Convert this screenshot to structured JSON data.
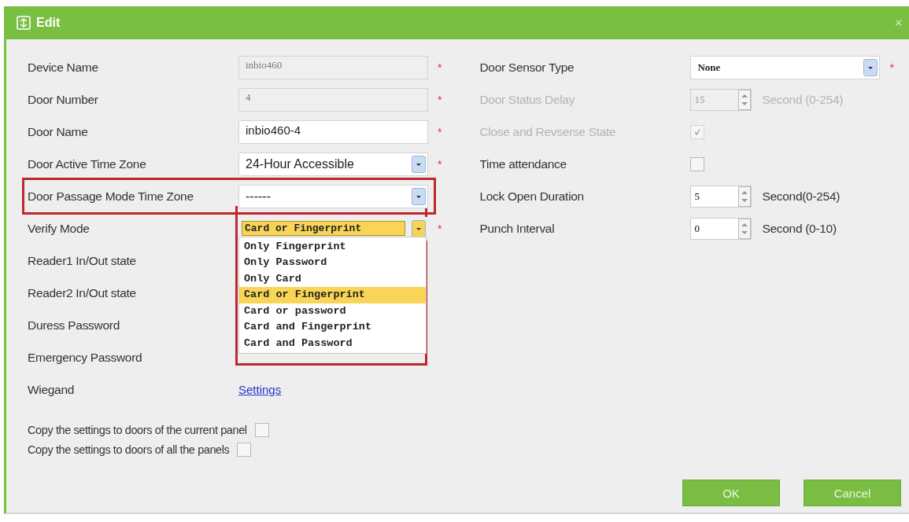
{
  "window": {
    "title": "Edit",
    "close": "×"
  },
  "left_fields": [
    {
      "label": "Device Name",
      "kind": "text",
      "value": "inbio460",
      "disabled": true,
      "required_mark": "*"
    },
    {
      "label": "Door Number",
      "kind": "text",
      "value": "4",
      "disabled": true,
      "required_mark": "*"
    },
    {
      "label": "Door Name",
      "kind": "text",
      "value": "inbio460-4",
      "disabled": false,
      "required_mark": "*"
    },
    {
      "label": "Door Active Time Zone",
      "kind": "select",
      "value": "24-Hour Accessible",
      "expanded": false,
      "required_mark": "*"
    },
    {
      "label": "Door Passage Mode Time Zone",
      "kind": "select",
      "value": "------",
      "expanded": false,
      "highlighted": true
    },
    {
      "label": "Verify Mode",
      "kind": "select",
      "value": "Card or Fingerprint",
      "expanded": true,
      "highlighted": true,
      "required_mark": "*",
      "options": [
        {
          "label": "Only Fingerprint",
          "selected": false
        },
        {
          "label": "Only Password",
          "selected": false
        },
        {
          "label": "Only Card",
          "selected": false
        },
        {
          "label": "Card or Fingerprint",
          "selected": true
        },
        {
          "label": "Card or password",
          "selected": false
        },
        {
          "label": "Card and Fingerprint",
          "selected": false
        },
        {
          "label": "Card and Password",
          "selected": false
        }
      ]
    },
    {
      "label": "Reader1 In/Out state",
      "kind": "covered"
    },
    {
      "label": "Reader2 In/Out state",
      "kind": "covered"
    },
    {
      "label": "Duress Password",
      "kind": "covered"
    },
    {
      "label": "Emergency Password",
      "kind": "covered"
    },
    {
      "label": "Wiegand",
      "kind": "link",
      "value": "Settings"
    }
  ],
  "right_fields": [
    {
      "label": "Door Sensor Type",
      "kind": "select",
      "value": "None",
      "expanded": false,
      "disabled": false,
      "required_mark": "*"
    },
    {
      "label": "Door Status Delay",
      "kind": "spinner",
      "value": "15",
      "unit": "Second (0-254)",
      "disabled": true
    },
    {
      "label": "Close and Revserse State",
      "kind": "checkbox",
      "checked": true,
      "disabled": true
    },
    {
      "label": "Time attendance",
      "kind": "checkbox",
      "checked": false,
      "disabled": false
    },
    {
      "label": "Lock Open Duration",
      "kind": "spinner",
      "value": "5",
      "unit": "Second(0-254)",
      "disabled": false
    },
    {
      "label": "Punch Interval",
      "kind": "spinner",
      "value": "0",
      "unit": "Second (0-10)",
      "disabled": false
    }
  ],
  "copy_options": [
    {
      "label": "Copy the settings to doors of the current panel",
      "checked": false
    },
    {
      "label": "Copy the settings to doors of all the panels",
      "checked": false
    }
  ],
  "buttons": [
    "OK",
    "Cancel"
  ]
}
